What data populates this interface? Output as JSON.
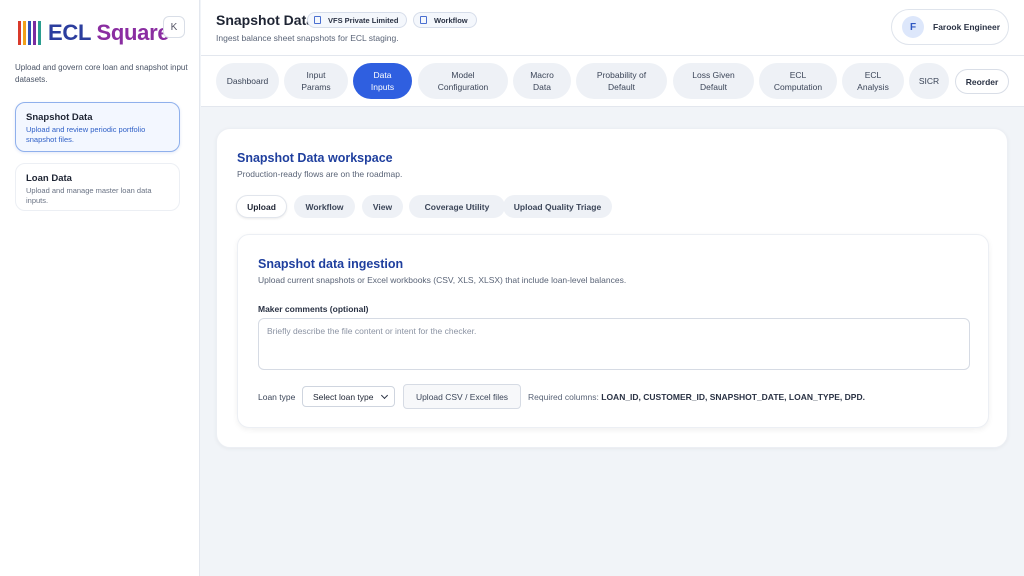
{
  "brand": {
    "logo_text": "ECL",
    "logo_text_accent": "Square"
  },
  "sidebar": {
    "collapse_label": "K",
    "description": "Upload and govern core loan and snapshot input datasets.",
    "items": [
      {
        "title": "Snapshot Data",
        "desc": "Upload and review periodic portfolio snapshot files."
      },
      {
        "title": "Loan Data",
        "desc": "Upload and manage master loan data inputs."
      }
    ]
  },
  "header": {
    "title": "Snapshot Data",
    "chips": [
      "VFS Private Limited",
      "Workflow"
    ],
    "subtitle": "Ingest balance sheet snapshots for ECL staging.",
    "user": {
      "initial": "F",
      "name": "Farook Engineer"
    }
  },
  "nav": {
    "tabs": [
      [
        "Dashboard"
      ],
      [
        "Input",
        "Params"
      ],
      [
        "Data",
        "Inputs"
      ],
      [
        "Model",
        "Configuration"
      ],
      [
        "Macro",
        "Data"
      ],
      [
        "Probability of",
        "Default"
      ],
      [
        "Loss Given",
        "Default"
      ],
      [
        "ECL",
        "Computation"
      ],
      [
        "ECL",
        "Analysis"
      ],
      [
        "SICR"
      ]
    ],
    "active_index": 2,
    "reorder_label": "Reorder"
  },
  "workspace": {
    "title": "Snapshot Data workspace",
    "subtitle": "Production-ready flows are on the roadmap.",
    "subtabs": [
      "Upload",
      "Workflow",
      "View",
      "Coverage Utility",
      "Upload Quality Triage"
    ],
    "active_subtab": 0
  },
  "ingestion": {
    "title": "Snapshot data ingestion",
    "subtitle": "Upload current snapshots or Excel workbooks (CSV, XLS, XLSX) that include loan-level balances.",
    "comments_label": "Maker comments (optional)",
    "comments_placeholder": "Briefly describe the file content or intent for the checker.",
    "loan_type_label": "Loan type",
    "loan_type_value": "Select loan type",
    "upload_button": "Upload CSV / Excel files",
    "required_prefix": "Required columns:",
    "required_columns": "LOAN_ID, CUSTOMER_ID, SNAPSHOT_DATE, LOAN_TYPE, DPD."
  },
  "colors": {
    "accent": "#2f5fe0",
    "heading": "#1f3f9e",
    "active_border": "#8fb0ec"
  }
}
